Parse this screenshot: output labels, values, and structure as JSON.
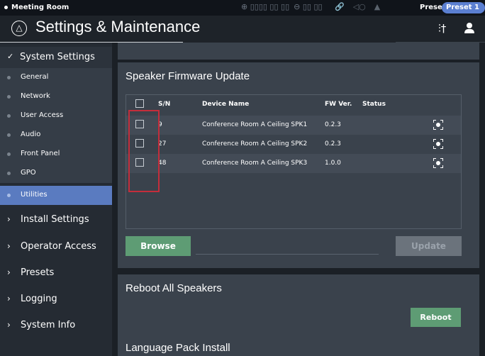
{
  "statusbar": {
    "room": "Meeting Room",
    "preset_label": "Preset",
    "preset_value": "Preset 1"
  },
  "titlebar": {
    "title": "Settings & Maintenance"
  },
  "sidebar": {
    "section_open": "System Settings",
    "sub_items": [
      {
        "label": "General"
      },
      {
        "label": "Network"
      },
      {
        "label": "User Access"
      },
      {
        "label": "Audio"
      },
      {
        "label": "Front Panel"
      },
      {
        "label": "GPO"
      },
      {
        "label": "Utilities",
        "active": true
      }
    ],
    "sections": [
      {
        "label": "Install Settings"
      },
      {
        "label": "Operator Access"
      },
      {
        "label": "Presets"
      },
      {
        "label": "Logging"
      },
      {
        "label": "System Info"
      }
    ]
  },
  "firmware": {
    "title": "Speaker Firmware Update",
    "columns": [
      "S/N",
      "Device Name",
      "FW Ver.",
      "Status"
    ],
    "rows": [
      {
        "sn": "9",
        "device": "Conference Room A Ceiling SPK1",
        "fw": "0.2.3",
        "status": ""
      },
      {
        "sn": "27",
        "device": "Conference Room A Ceiling SPK2",
        "fw": "0.2.3",
        "status": ""
      },
      {
        "sn": "48",
        "device": "Conference Room A Ceiling SPK3",
        "fw": "1.0.0",
        "status": ""
      }
    ],
    "browse_label": "Browse",
    "update_label": "Update"
  },
  "reboot": {
    "title": "Reboot All Speakers",
    "button_label": "Reboot"
  },
  "language": {
    "title": "Language Pack Install"
  },
  "colors": {
    "accent_green": "#5e9c74",
    "active_blue": "#5a7bc0",
    "highlight_red": "#c42d3b"
  }
}
